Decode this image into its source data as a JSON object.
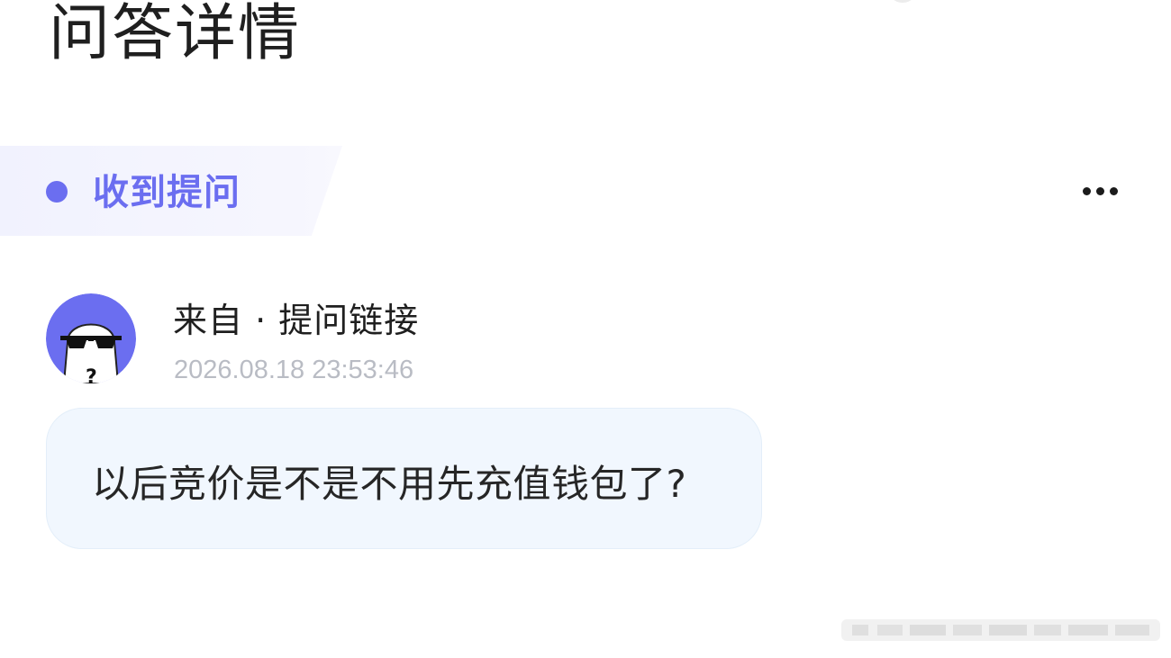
{
  "page": {
    "title": "问答详情"
  },
  "section": {
    "label": "收到提问"
  },
  "question_card": {
    "sender": "来自 · 提问链接",
    "timestamp": "2026.08.18 23:53:46",
    "question": "以后竞价是不是不用先充值钱包了?",
    "avatar": "masked-character-avatar"
  },
  "actions": {
    "more_icon": "more-horizontal-icon"
  },
  "colors": {
    "accent": "#6b6ef0",
    "avatar_bg": "#6b6ef0",
    "bubble_bg": "#f1f7fe",
    "timestamp": "#b9bcc4",
    "text": "#1f1f1f"
  }
}
